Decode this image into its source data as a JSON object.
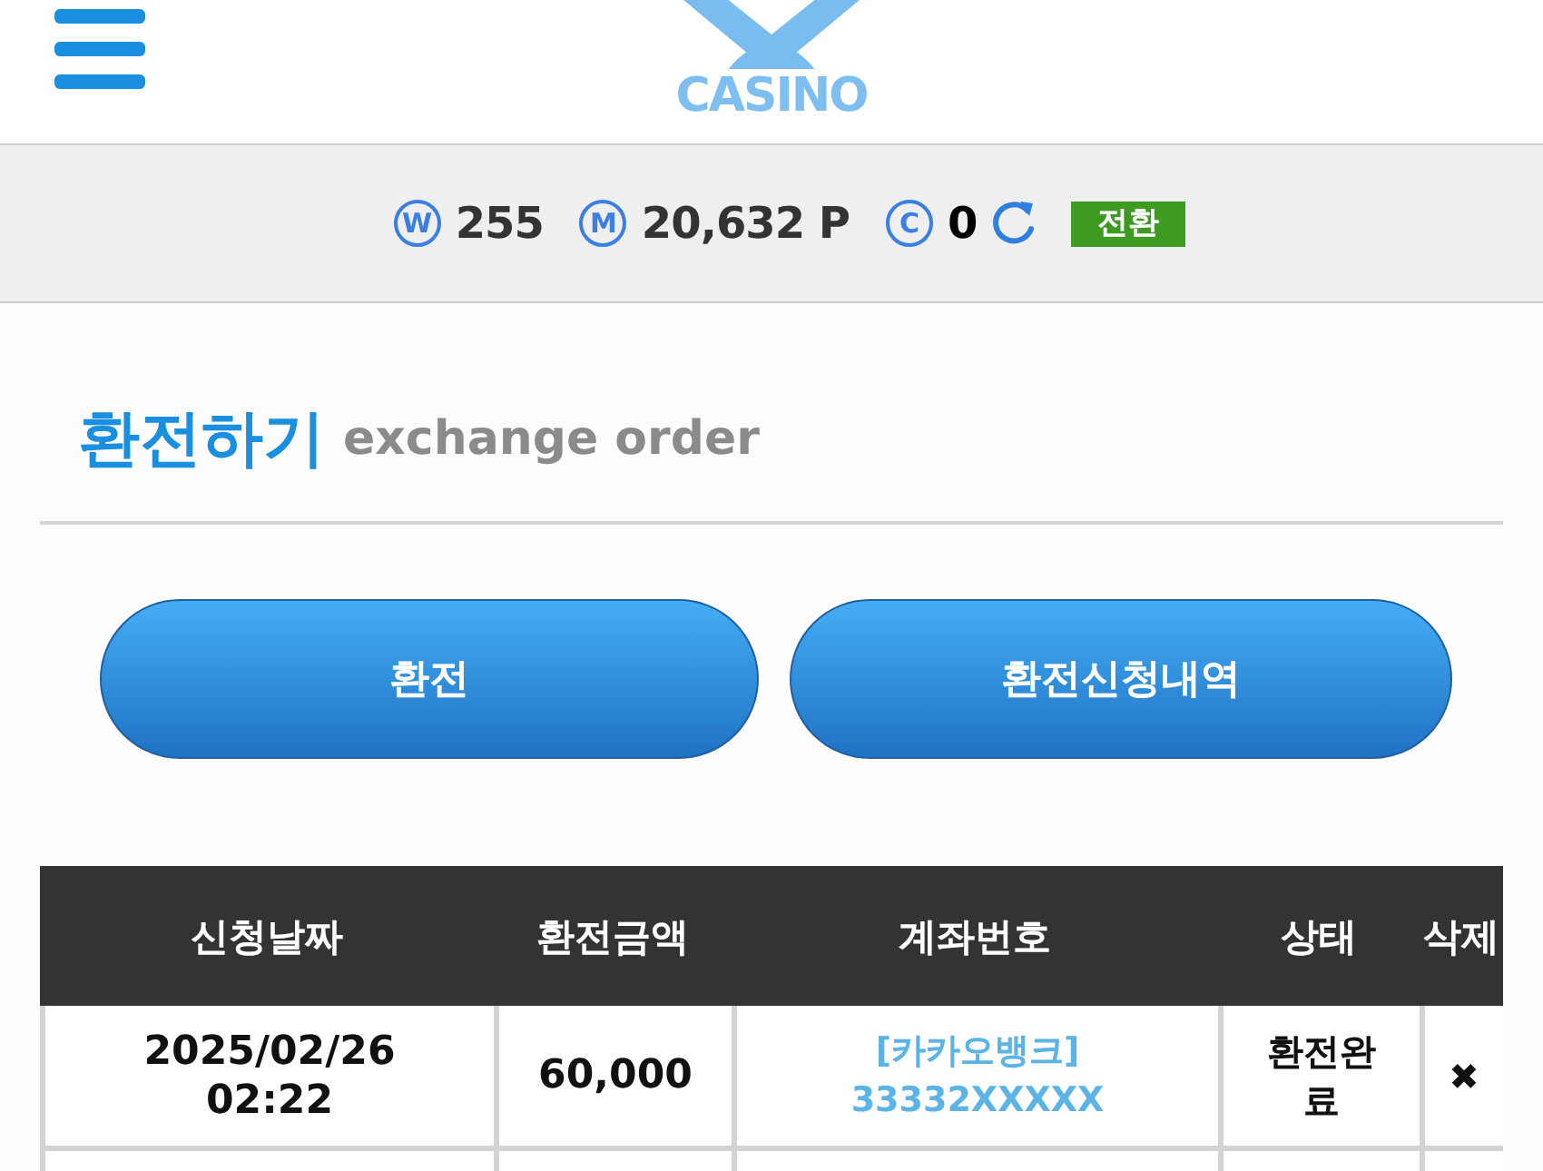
{
  "header": {
    "logo": {
      "text": "CASINO"
    }
  },
  "balance_bar": {
    "items": [
      {
        "symbol": "W",
        "value": "255"
      },
      {
        "symbol": "M",
        "value": "20,632 P"
      },
      {
        "symbol": "C",
        "value": "0"
      }
    ],
    "convert_button": "전환"
  },
  "title": {
    "main": "환전하기",
    "sub": "exchange order"
  },
  "actions": [
    {
      "label": "환전"
    },
    {
      "label": "환전신청내역"
    }
  ],
  "table": {
    "columns": [
      "신청날짜",
      "환전금액",
      "계좌번호",
      "상태",
      "삭제"
    ],
    "rows": [
      {
        "date": "2025/02/26 02:22",
        "amount": "60,000",
        "bank": "[카카오뱅크]",
        "account": "33332XXXXX",
        "status": "환전완료",
        "delete": "✖"
      }
    ]
  }
}
